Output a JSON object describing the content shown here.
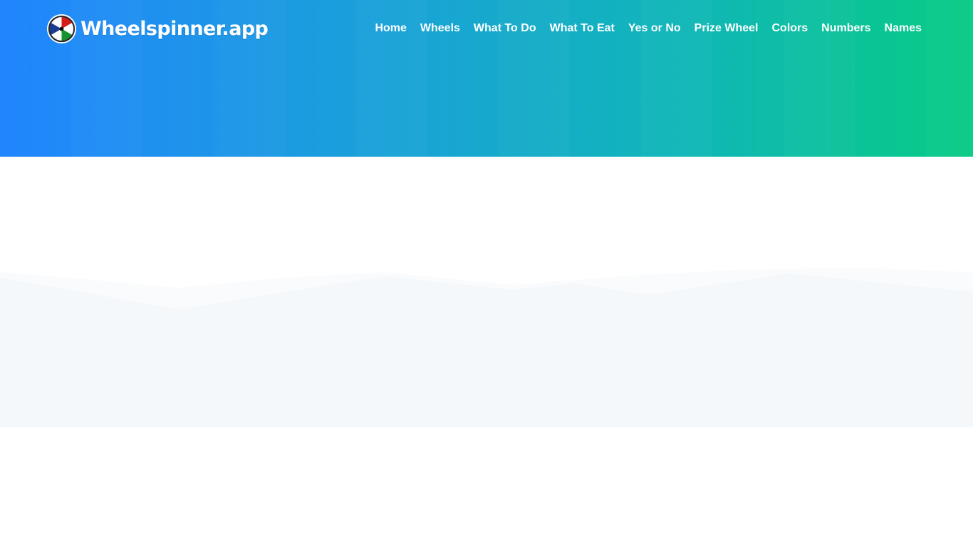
{
  "header": {
    "brand": {
      "name": "Wheelspinner.app",
      "logo_icon": "spinning-wheel-logo-icon",
      "logo_colors": [
        "#d61b1b",
        "#ffffff",
        "#17942f",
        "#ffffff",
        "#1b3c8f",
        "#ffffff"
      ]
    },
    "nav": [
      {
        "label": "Home"
      },
      {
        "label": "Wheels"
      },
      {
        "label": "What To Do"
      },
      {
        "label": "What To Eat"
      },
      {
        "label": "Yes or No"
      },
      {
        "label": "Prize Wheel"
      },
      {
        "label": "Colors"
      },
      {
        "label": "Numbers"
      },
      {
        "label": "Names"
      }
    ]
  },
  "colors": {
    "gradient_start": "#2185fe",
    "gradient_end": "#08cb84",
    "wave_fill": "#f4f8fb",
    "page_background": "#ffffff"
  }
}
